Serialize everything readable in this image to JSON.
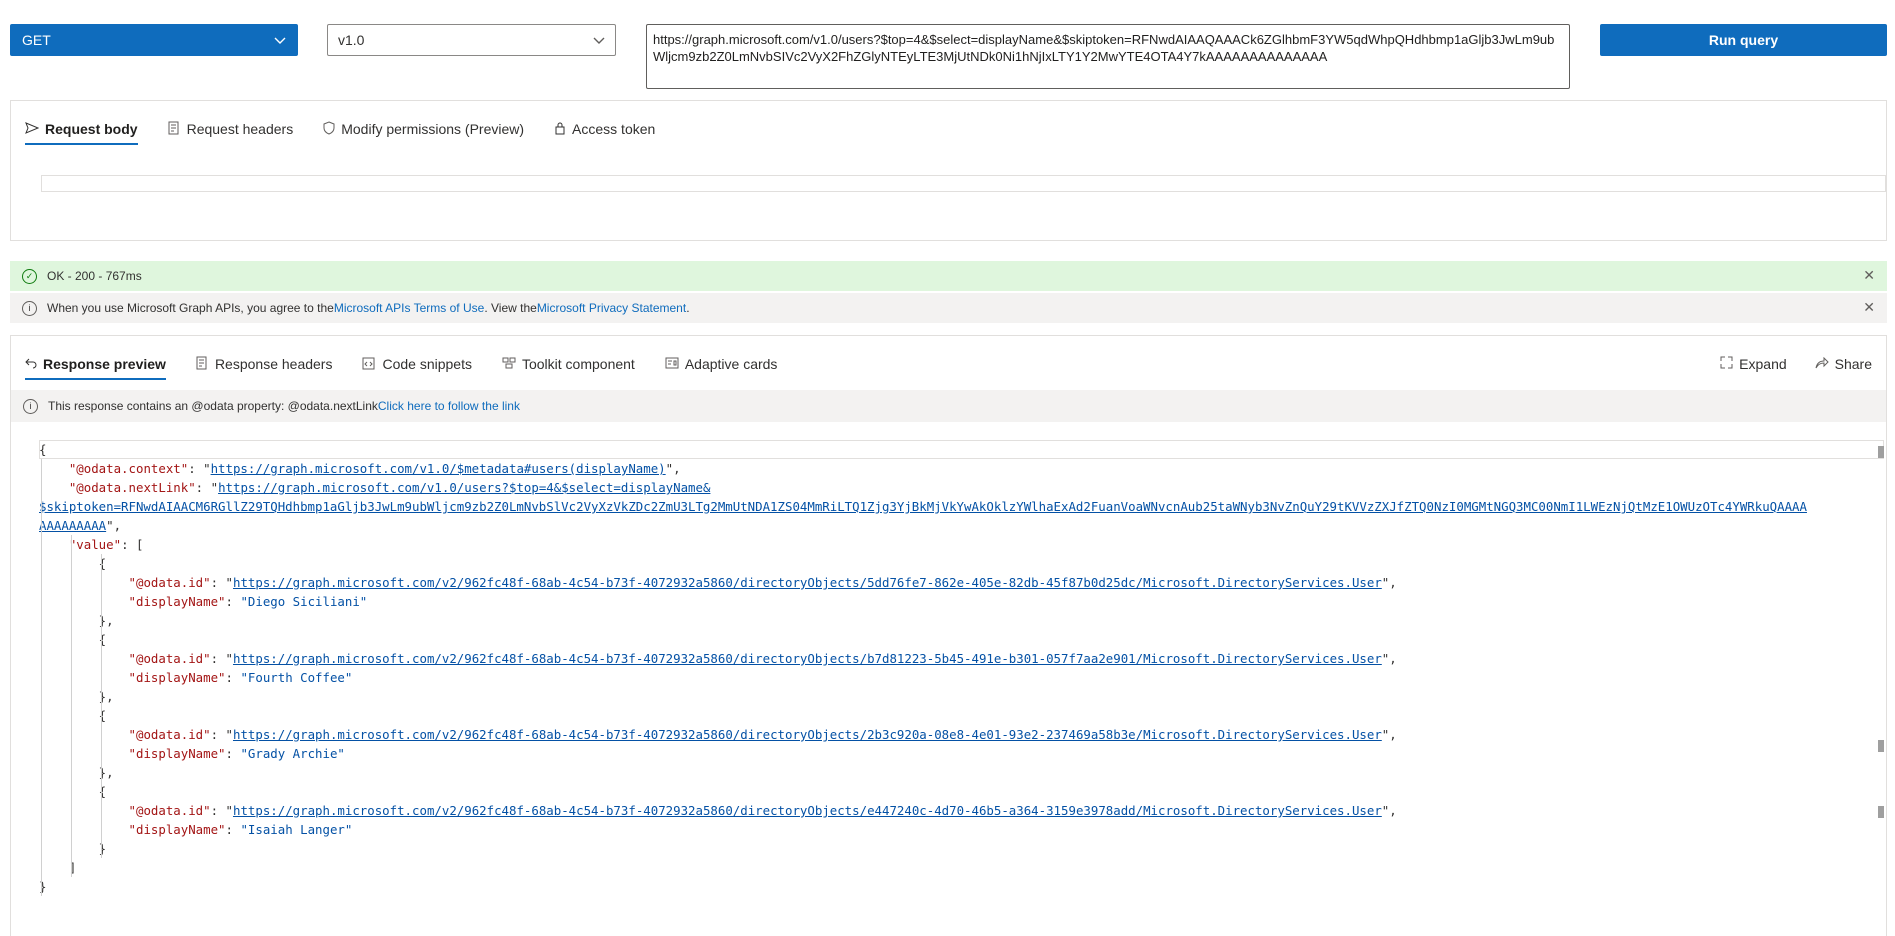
{
  "query": {
    "method": "GET",
    "version": "v1.0",
    "url": "https://graph.microsoft.com/v1.0/users?$top=4&$select=displayName&$skiptoken=RFNwdAIAAQAAACk6ZGlhbmF3YW5qdWhpQHdhbmp1aGljb3JwLm9ubWljcm9zb2Z0LmNvbSIVc2VyX2FhZGlyNTEyLTE3MjUtNDk0Ni1hNjIxLTY1Y2MwYTE4OTA4Y7kAAAAAAAAAAAAAA",
    "run_label": "Run query"
  },
  "request_tabs": [
    {
      "label": "Request body",
      "icon": "send-icon"
    },
    {
      "label": "Request headers",
      "icon": "headers-icon"
    },
    {
      "label": "Modify permissions (Preview)",
      "icon": "shield-icon"
    },
    {
      "label": "Access token",
      "icon": "lock-icon"
    }
  ],
  "status": {
    "text": "OK - 200 - 767ms",
    "color": "#dff6dd"
  },
  "terms": {
    "prefix": "When you use Microsoft Graph APIs, you agree to the ",
    "link1": "Microsoft APIs Terms of Use",
    "middle": ". View the ",
    "link2": "Microsoft Privacy Statement",
    "suffix": "."
  },
  "response_tabs": [
    {
      "label": "Response preview",
      "icon": "undo-icon"
    },
    {
      "label": "Response headers",
      "icon": "headers-icon"
    },
    {
      "label": "Code snippets",
      "icon": "code-icon"
    },
    {
      "label": "Toolkit component",
      "icon": "toolkit-icon"
    },
    {
      "label": "Adaptive cards",
      "icon": "card-icon"
    }
  ],
  "response_actions": {
    "expand": "Expand",
    "share": "Share"
  },
  "odata_notice": {
    "text": "This response contains an @odata property: @odata.nextLink ",
    "link": "Click here to follow the link"
  },
  "response": {
    "context_key": "\"@odata.context\"",
    "context_url": "https://graph.microsoft.com/v1.0/$metadata#users(displayName)",
    "nextlink_key": "\"@odata.nextLink\"",
    "nextlink_url_1": "https://graph.microsoft.com/v1.0/users?$top=4&$select=displayName&",
    "nextlink_url_2": "$skiptoken=RFNwdAIAACM6RGllZ29TQHdhbmp1aGljb3JwLm9ubWljcm9zb2Z0LmNvbSlVc2VyXzVkZDc2ZmU3LTg2MmUtNDA1ZS04MmRiLTQ1Zjg3YjBkMjVkYwAkOklzYWlhaExAd2FuanVoaWNvcnAub25taWNyb3NvZnQuY29tKVVzZXJfZTQ0NzI0MGMtNGQ3MC00NmI1LWEzNjQtMzE1OWUzOTc4YWRkuQAAAA",
    "nextlink_url_3": "AAAAAAAAA",
    "value_key": "\"value\"",
    "items": [
      {
        "id": "https://graph.microsoft.com/v2/962fc48f-68ab-4c54-b73f-4072932a5860/directoryObjects/5dd76fe7-862e-405e-82db-45f87b0d25dc/Microsoft.DirectoryServices.User",
        "displayName": "\"Diego Siciliani\""
      },
      {
        "id": "https://graph.microsoft.com/v2/962fc48f-68ab-4c54-b73f-4072932a5860/directoryObjects/b7d81223-5b45-491e-b301-057f7aa2e901/Microsoft.DirectoryServices.User",
        "displayName": "\"Fourth Coffee\""
      },
      {
        "id": "https://graph.microsoft.com/v2/962fc48f-68ab-4c54-b73f-4072932a5860/directoryObjects/2b3c920a-08e8-4e01-93e2-237469a58b3e/Microsoft.DirectoryServices.User",
        "displayName": "\"Grady Archie\""
      },
      {
        "id": "https://graph.microsoft.com/v2/962fc48f-68ab-4c54-b73f-4072932a5860/directoryObjects/e447240c-4d70-46b5-a364-3159e3978add/Microsoft.DirectoryServices.User",
        "displayName": "\"Isaiah Langer\""
      }
    ],
    "id_key": "\"@odata.id\"",
    "displayname_key": "\"displayName\""
  },
  "colors": {
    "accent": "#0f6cbd",
    "key": "#a31515",
    "string": "#0451a5"
  }
}
